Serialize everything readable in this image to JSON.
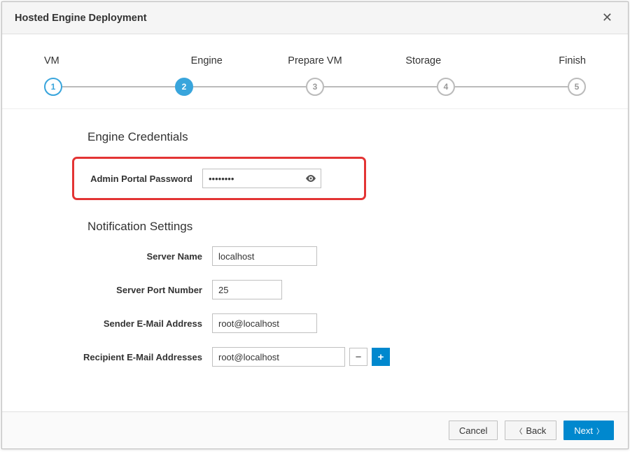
{
  "header": {
    "title": "Hosted Engine Deployment"
  },
  "wizard": {
    "steps": [
      {
        "label": "VM",
        "num": "1",
        "state": "done"
      },
      {
        "label": "Engine",
        "num": "2",
        "state": "active"
      },
      {
        "label": "Prepare VM",
        "num": "3",
        "state": "future"
      },
      {
        "label": "Storage",
        "num": "4",
        "state": "future"
      },
      {
        "label": "Finish",
        "num": "5",
        "state": "future"
      }
    ]
  },
  "sections": {
    "creds_title": "Engine Credentials",
    "notif_title": "Notification Settings"
  },
  "form": {
    "admin_pwd_label": "Admin Portal Password",
    "admin_pwd_value": "••••••••",
    "server_name_label": "Server Name",
    "server_name_value": "localhost",
    "server_port_label": "Server Port Number",
    "server_port_value": "25",
    "sender_label": "Sender E-Mail Address",
    "sender_value": "root@localhost",
    "recipients_label": "Recipient E-Mail Addresses",
    "recipients_value": "root@localhost"
  },
  "footer": {
    "cancel_label": "Cancel",
    "back_label": "Back",
    "next_label": "Next"
  }
}
